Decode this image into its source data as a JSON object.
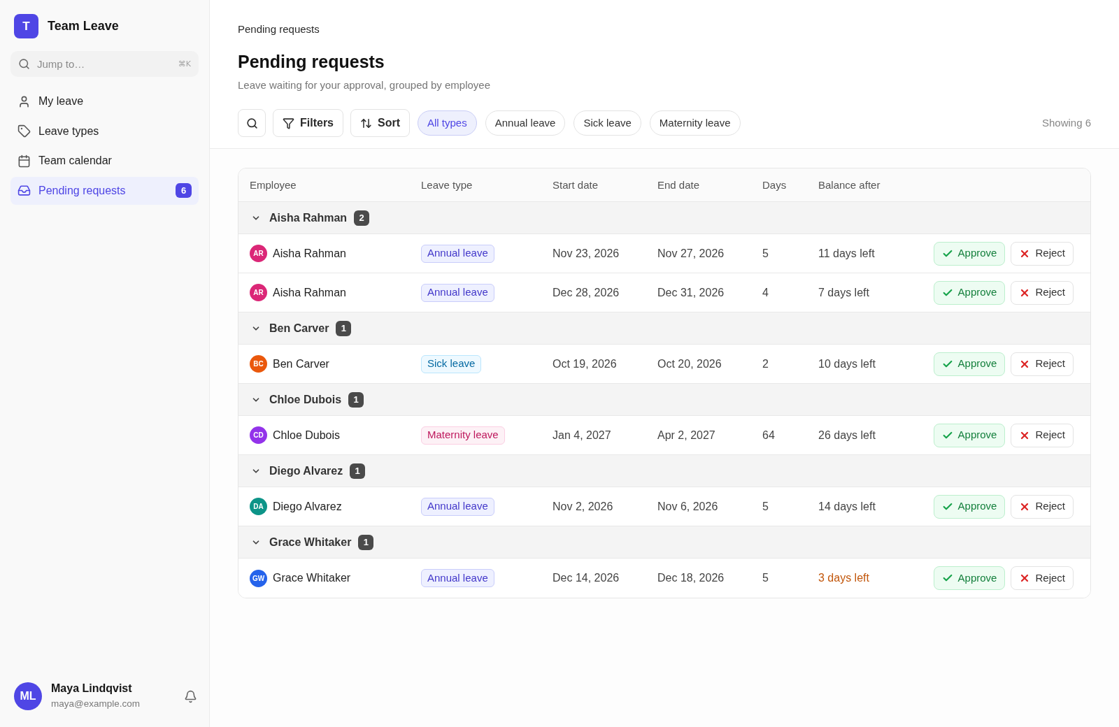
{
  "sidebar": {
    "logo_letter": "T",
    "app_name": "Team Leave",
    "search": {
      "placeholder": "Jump to…",
      "shortcut": "⌘K"
    },
    "items": [
      {
        "label": "My leave",
        "selected": false
      },
      {
        "label": "Leave types",
        "selected": false
      },
      {
        "label": "Team calendar",
        "selected": false
      },
      {
        "label": "Pending requests",
        "selected": true,
        "badge": "6"
      }
    ],
    "user": {
      "initials": "ML",
      "name": "Maya Lindqvist",
      "email": "maya@example.com"
    }
  },
  "header": {
    "breadcrumb": "Pending requests",
    "title": "Pending requests",
    "subtitle": "Leave waiting for your approval, grouped by employee"
  },
  "toolbar": {
    "filters_label": "Filters",
    "sort_label": "Sort",
    "chips": [
      {
        "label": "All types",
        "selected": true
      },
      {
        "label": "Annual leave",
        "selected": false
      },
      {
        "label": "Sick leave",
        "selected": false
      },
      {
        "label": "Maternity leave",
        "selected": false
      }
    ],
    "result_count": "Showing 6"
  },
  "table": {
    "columns": [
      "Employee",
      "Leave type",
      "Start date",
      "End date",
      "Days",
      "Balance after"
    ],
    "groups": [
      {
        "name": "Aisha Rahman",
        "count": "2",
        "expanded": true,
        "rows": [
          {
            "initials": "AR",
            "color": "#db2777",
            "employee": "Aisha Rahman",
            "leave_type": {
              "label": "Annual leave",
              "kind": "annual"
            },
            "start": "Nov 23, 2026",
            "end": "Nov 27, 2026",
            "days": "5",
            "balance": "11 days left",
            "balance_low": false,
            "approve_label": "Approve",
            "reject_label": "Reject"
          },
          {
            "initials": "AR",
            "color": "#db2777",
            "employee": "Aisha Rahman",
            "leave_type": {
              "label": "Annual leave",
              "kind": "annual"
            },
            "start": "Dec 28, 2026",
            "end": "Dec 31, 2026",
            "days": "4",
            "balance": "7 days left",
            "balance_low": false,
            "approve_label": "Approve",
            "reject_label": "Reject"
          }
        ]
      },
      {
        "name": "Ben Carver",
        "count": "1",
        "expanded": true,
        "rows": [
          {
            "initials": "BC",
            "color": "#ea580c",
            "employee": "Ben Carver",
            "leave_type": {
              "label": "Sick leave",
              "kind": "sick"
            },
            "start": "Oct 19, 2026",
            "end": "Oct 20, 2026",
            "days": "2",
            "balance": "10 days left",
            "balance_low": false,
            "approve_label": "Approve",
            "reject_label": "Reject"
          }
        ]
      },
      {
        "name": "Chloe Dubois",
        "count": "1",
        "expanded": true,
        "rows": [
          {
            "initials": "CD",
            "color": "#9333ea",
            "employee": "Chloe Dubois",
            "leave_type": {
              "label": "Maternity leave",
              "kind": "maternity"
            },
            "start": "Jan 4, 2027",
            "end": "Apr 2, 2027",
            "days": "64",
            "balance": "26 days left",
            "balance_low": false,
            "approve_label": "Approve",
            "reject_label": "Reject"
          }
        ]
      },
      {
        "name": "Diego Alvarez",
        "count": "1",
        "expanded": true,
        "rows": [
          {
            "initials": "DA",
            "color": "#0d9488",
            "employee": "Diego Alvarez",
            "leave_type": {
              "label": "Annual leave",
              "kind": "annual"
            },
            "start": "Nov 2, 2026",
            "end": "Nov 6, 2026",
            "days": "5",
            "balance": "14 days left",
            "balance_low": false,
            "approve_label": "Approve",
            "reject_label": "Reject"
          }
        ]
      },
      {
        "name": "Grace Whitaker",
        "count": "1",
        "expanded": true,
        "rows": [
          {
            "initials": "GW",
            "color": "#2563eb",
            "employee": "Grace Whitaker",
            "leave_type": {
              "label": "Annual leave",
              "kind": "annual"
            },
            "start": "Dec 14, 2026",
            "end": "Dec 18, 2026",
            "days": "5",
            "balance": "3 days left",
            "balance_low": true,
            "approve_label": "Approve",
            "reject_label": "Reject"
          }
        ]
      }
    ]
  }
}
